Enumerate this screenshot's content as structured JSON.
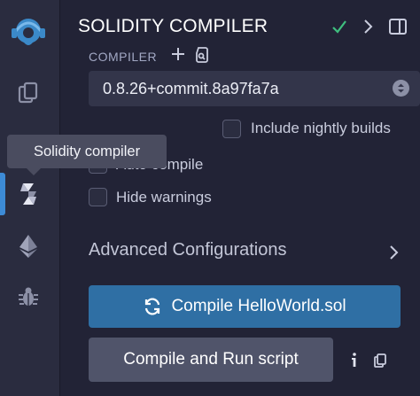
{
  "sidebar": {
    "icons": [
      {
        "name": "remix-logo-icon"
      },
      {
        "name": "file-explorer-icon"
      },
      {
        "name": "solidity-compiler-icon"
      },
      {
        "name": "deploy-run-icon"
      },
      {
        "name": "debugger-icon"
      }
    ],
    "active_index": 2,
    "accent_color": "#3d8bd6"
  },
  "header": {
    "title": "SOLIDITY COMPILER",
    "check_color": "#3fbf7f"
  },
  "compiler": {
    "label": "COMPILER",
    "selected_version": "0.8.26+commit.8a97fa7a"
  },
  "options": {
    "include_nightly": "Include nightly builds",
    "auto_compile": "Auto compile",
    "hide_warnings": "Hide warnings"
  },
  "advanced": {
    "label": "Advanced Configurations"
  },
  "buttons": {
    "compile_label": "Compile HelloWorld.sol",
    "compile_color": "#2f6fa4",
    "run_script_label": "Compile and Run script"
  },
  "tooltip": {
    "text": "Solidity compiler"
  }
}
